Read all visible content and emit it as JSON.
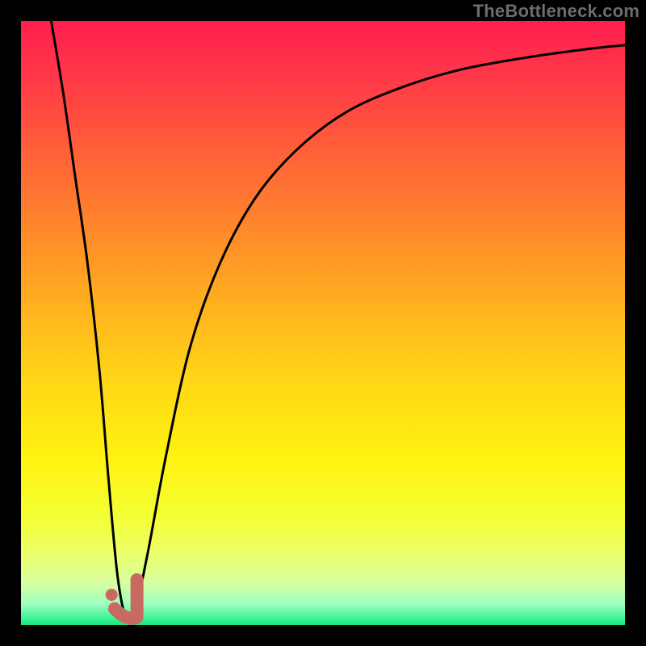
{
  "watermark": {
    "text": "TheBottleneck.com"
  },
  "colors": {
    "black": "#000000",
    "curve": "#000000",
    "marker_fill": "#c96a61",
    "marker_stroke": "#c96a61"
  },
  "gradient_stops": [
    {
      "offset": 0.0,
      "color": "#ff1f4e"
    },
    {
      "offset": 0.1,
      "color": "#ff3a47"
    },
    {
      "offset": 0.22,
      "color": "#ff6138"
    },
    {
      "offset": 0.35,
      "color": "#ff8a2a"
    },
    {
      "offset": 0.48,
      "color": "#ffb41e"
    },
    {
      "offset": 0.6,
      "color": "#ffd716"
    },
    {
      "offset": 0.72,
      "color": "#fff20f"
    },
    {
      "offset": 0.82,
      "color": "#f4ff33"
    },
    {
      "offset": 0.88,
      "color": "#ecff6a"
    },
    {
      "offset": 0.93,
      "color": "#d8ffa0"
    },
    {
      "offset": 0.965,
      "color": "#9effc0"
    },
    {
      "offset": 0.985,
      "color": "#4cf6a0"
    },
    {
      "offset": 1.0,
      "color": "#17e87c"
    }
  ],
  "chart_data": {
    "type": "line",
    "title": "",
    "xlabel": "",
    "ylabel": "",
    "xlim": [
      0,
      100
    ],
    "ylim": [
      0,
      100
    ],
    "grid": false,
    "series": [
      {
        "name": "bottleneck-curve",
        "x": [
          5,
          7,
          9,
          11,
          13,
          14.5,
          16,
          17.5,
          19,
          21,
          24,
          28,
          33,
          39,
          46,
          54,
          63,
          73,
          84,
          95,
          100
        ],
        "y": [
          100,
          88,
          74,
          60,
          42,
          24,
          8,
          1,
          3,
          12,
          28,
          46,
          60,
          71,
          79,
          85,
          89,
          92,
          94,
          95.5,
          96
        ]
      }
    ],
    "annotations": [
      {
        "name": "min-marker-hook",
        "shape": "J",
        "x_range": [
          15.5,
          19.2
        ],
        "y_range": [
          0.5,
          7.5
        ]
      },
      {
        "name": "min-marker-dot",
        "shape": "dot",
        "x": 15.0,
        "y": 5.0
      }
    ]
  }
}
